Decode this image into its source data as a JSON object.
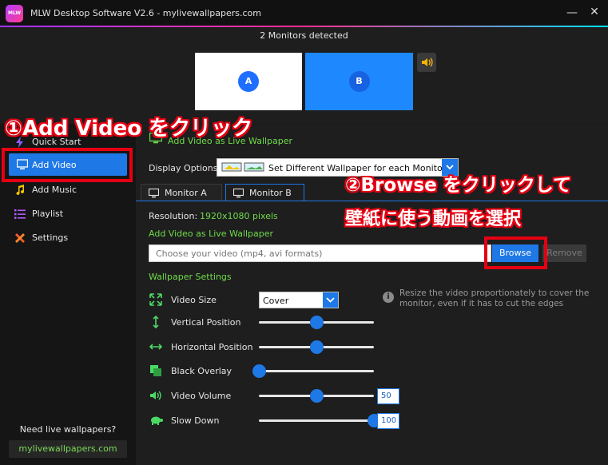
{
  "titlebar": {
    "logo_text": "MLW",
    "title": "MLW Desktop Software V2.6 - mylivewallpapers.com",
    "minimize": "—",
    "close": "✕"
  },
  "monitors": {
    "detected_text": "2 Monitors detected",
    "a_label": "A",
    "b_label": "B"
  },
  "sidebar": {
    "items": [
      {
        "label": "Quick Start",
        "icon": "lightning-icon"
      },
      {
        "label": "Add Video",
        "icon": "monitor-icon",
        "active": true
      },
      {
        "label": "Add Music",
        "icon": "music-note-icon"
      },
      {
        "label": "Playlist",
        "icon": "list-icon"
      },
      {
        "label": "Settings",
        "icon": "wrench-icon"
      }
    ],
    "need_text": "Need live wallpapers?",
    "site_link": "mylivewallpapers.com"
  },
  "main": {
    "header_label": "Add Video as Live Wallpaper",
    "display_options_label": "Display Options:",
    "display_option_value": "Set Different Wallpaper for each Monitor",
    "tabs": [
      {
        "label": "Monitor A"
      },
      {
        "label": "Monitor B",
        "active": true
      }
    ],
    "resolution_label": "Resolution:",
    "resolution_value": "1920x1080 pixels",
    "sub_label": "Add Video as Live Wallpaper",
    "video_input_placeholder": "Choose your video (mp4, avi formats)",
    "browse_label": "Browse",
    "remove_label": "Remove",
    "wallpaper_settings_label": "Wallpaper Settings",
    "settings": {
      "video_size_label": "Video Size",
      "video_size_value": "Cover",
      "info_icon": "i",
      "info_text": "Resize the video proportionately to cover the monitor, even if it has to cut the edges",
      "vertical_position_label": "Vertical Position",
      "vertical_position_value": 0.5,
      "horizontal_position_label": "Horizontal Position",
      "horizontal_position_value": 0.5,
      "black_overlay_label": "Black Overlay",
      "black_overlay_value": 0.0,
      "video_volume_label": "Video Volume",
      "video_volume_value": "50",
      "slow_down_label": "Slow Down",
      "slow_down_value": "100"
    }
  },
  "annotations": {
    "step1": "①Add Video をクリック",
    "step2_line1": "②Browse をクリックして",
    "step2_line2": "壁紙に使う動画を選択"
  },
  "colors": {
    "accent_blue": "#1e78e6",
    "label_green": "#6fdc4a",
    "annotation_red": "#e60012"
  }
}
